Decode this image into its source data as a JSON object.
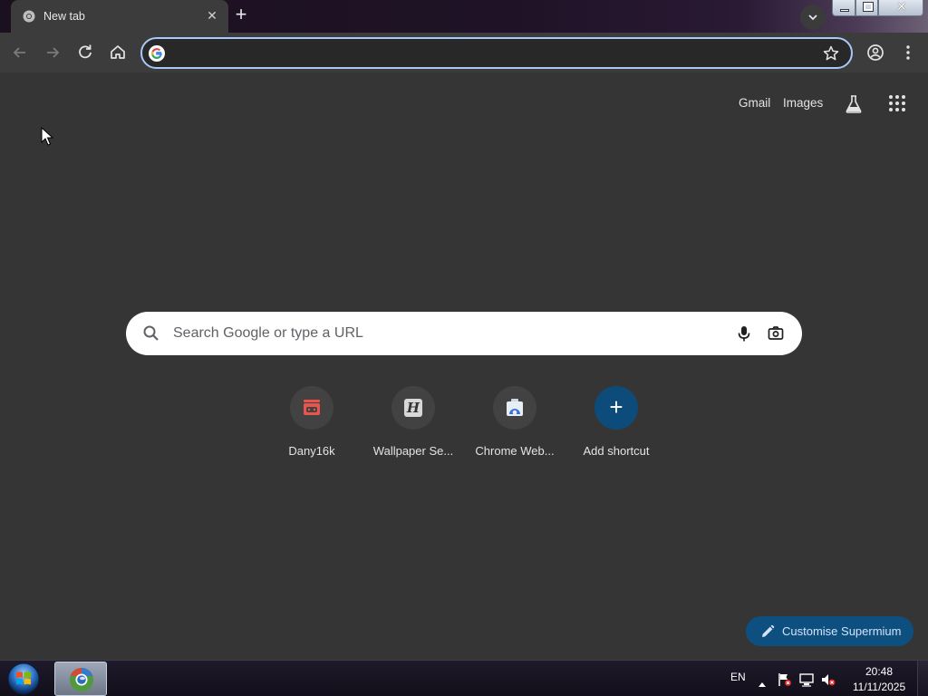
{
  "tabs": [
    {
      "title": "New tab",
      "favicon": "chrome-icon",
      "active": true
    }
  ],
  "tab_strip": {
    "new_tab_symbol": "+",
    "close_symbol": "✕",
    "tab_search_icon": "chevron-down-icon"
  },
  "window_controls": {
    "minimize_icon": "minimize-icon",
    "maximize_icon": "restore-icon",
    "close_symbol": "✕"
  },
  "toolbar": {
    "back_icon": "back-arrow-icon",
    "forward_icon": "forward-arrow-icon",
    "reload_icon": "reload-icon",
    "home_icon": "home-icon",
    "omnibox": {
      "value": "",
      "placeholder": ""
    },
    "bookmark_icon": "star-icon",
    "profile_icon": "profile-icon",
    "menu_icon": "kebab-menu-icon"
  },
  "ntp": {
    "header_links": {
      "gmail": "Gmail",
      "images": "Images"
    },
    "labs_icon": "labs-flask-icon",
    "apps_icon": "apps-grid-icon",
    "search": {
      "placeholder": "Search Google or type a URL",
      "value": ""
    },
    "shortcuts": [
      {
        "label": "Dany16k",
        "icon": "store-icon"
      },
      {
        "label": "Wallpaper Se...",
        "icon": "wallpaper-h-icon"
      },
      {
        "label": "Chrome Web...",
        "icon": "chrome-web-store-icon"
      },
      {
        "label": "Add shortcut",
        "icon": "plus-icon"
      }
    ],
    "customise_label": "Customise Supermium"
  },
  "taskbar": {
    "language": "EN",
    "clock_time": "20:48",
    "clock_date": "11/11/2025",
    "tray_icons": [
      "show-hidden-icons-arrow",
      "action-center-flag-icon",
      "network-icon",
      "volume-muted-icon"
    ]
  },
  "colors": {
    "page_bg": "#353535",
    "toolbar_bg": "#3c3c3c",
    "omnibox_focus": "#a8c7fa",
    "accent_button": "#0d4f7e",
    "tile_bg": "#424242"
  }
}
